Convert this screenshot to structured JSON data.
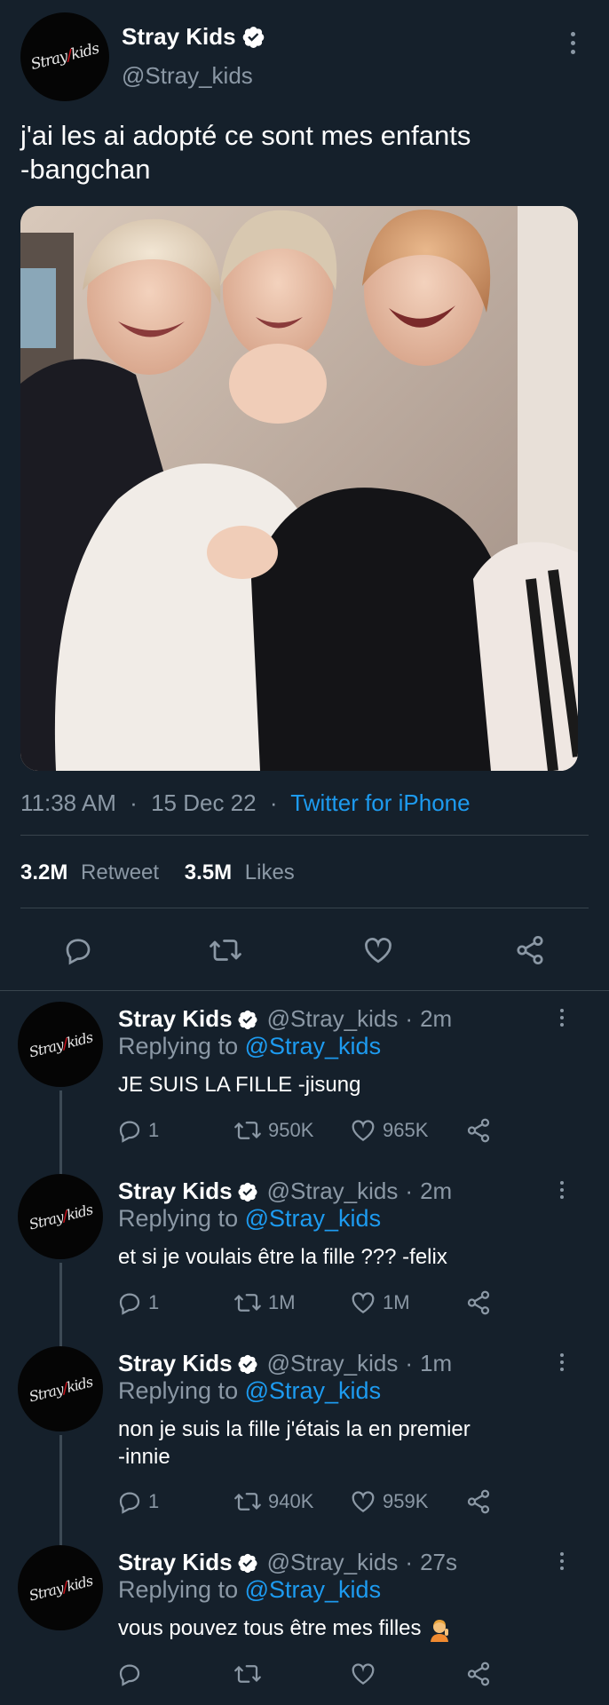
{
  "main_tweet": {
    "author_name": "Stray Kids",
    "author_handle": "@Stray_kids",
    "avatar_logo": "Stray Kids",
    "text_line1": "j'ai les ai adopté ce sont mes enfants",
    "text_line2": "-bangchan",
    "photo_description_icon": "photo",
    "time": "11:38 AM",
    "sep1": "·",
    "date": "15 Dec 22",
    "sep2": "·",
    "source": "Twitter for iPhone",
    "retweets_count": "3.2M",
    "retweets_label": "Retweet",
    "likes_count": "3.5M",
    "likes_label": "Likes"
  },
  "replies": [
    {
      "author_name": "Stray Kids",
      "author_handle": "@Stray_kids",
      "dot": "·",
      "time": "2m",
      "replying_label": "Replying to",
      "replying_mention": "@Stray_kids",
      "text_line1": "JE SUIS LA FILLE -jisung",
      "text_line2": "",
      "reply_count": "1",
      "retweet_count": "950K",
      "like_count": "965K"
    },
    {
      "author_name": "Stray Kids",
      "author_handle": "@Stray_kids",
      "dot": "·",
      "time": "2m",
      "replying_label": "Replying to",
      "replying_mention": "@Stray_kids",
      "text_line1": "et si je voulais être la fille ??? -felix",
      "text_line2": "",
      "reply_count": "1",
      "retweet_count": "1M",
      "like_count": "1M"
    },
    {
      "author_name": "Stray Kids",
      "author_handle": "@Stray_kids",
      "dot": "·",
      "time": "1m",
      "replying_label": "Replying to",
      "replying_mention": "@Stray_kids",
      "text_line1": "non je suis la fille j'étais la en premier",
      "text_line2": "-innie",
      "reply_count": "1",
      "retweet_count": "940K",
      "like_count": "959K"
    },
    {
      "author_name": "Stray Kids",
      "author_handle": "@Stray_kids",
      "dot": "·",
      "time": "27s",
      "replying_label": "Replying to",
      "replying_mention": "@Stray_kids",
      "text_line1": "vous pouvez tous être mes filles",
      "text_line2": "",
      "reply_count": "",
      "retweet_count": "",
      "like_count": ""
    }
  ],
  "colors": {
    "background": "#15202b",
    "accent": "#1d9bf0",
    "muted": "#8b98a5",
    "divider": "#38444d"
  },
  "icons": [
    "verified-badge-icon",
    "more-options-icon",
    "reply-icon",
    "retweet-icon",
    "like-icon",
    "share-icon",
    "person-gesturing-emoji"
  ]
}
